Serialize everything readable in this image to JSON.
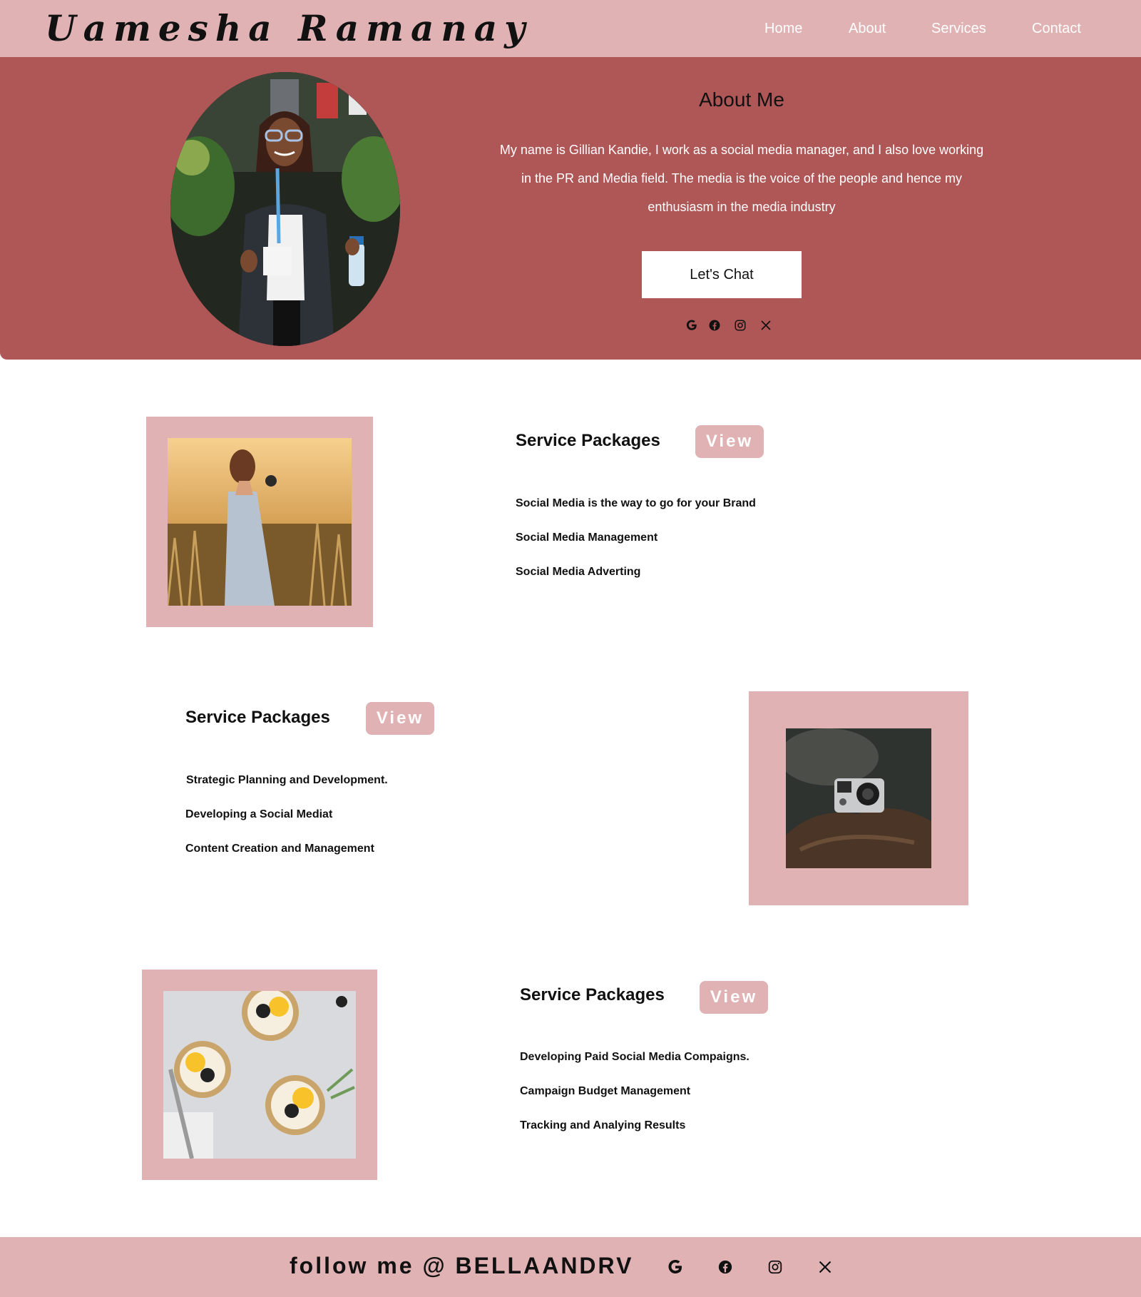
{
  "header": {
    "brand": "Uamesha Ramanay",
    "nav": [
      "Home",
      "About",
      "Services",
      "Contact"
    ]
  },
  "hero": {
    "title": "About Me",
    "text": "My name is Gillian Kandie, I work as a social media manager, and I also love working in the PR and Media field. The media is the voice of the people and hence my enthusiasm in the media industry",
    "button": "Let's Chat",
    "socials": [
      "google-icon",
      "facebook-icon",
      "instagram-icon",
      "x-icon"
    ]
  },
  "services": [
    {
      "title": "Service Packages",
      "view": "View",
      "items": [
        "Social Media is the way to go for your Brand",
        "Social Media Management",
        "Social Media Adverting"
      ]
    },
    {
      "title": "Service Packages",
      "view": "View",
      "items": [
        "Strategic Planning and Development.",
        "Developing a Social Mediat",
        "Content Creation and Management"
      ]
    },
    {
      "title": "Service Packages",
      "view": "View",
      "items": [
        "Developing Paid Social Media Compaigns.",
        "Campaign Budget Management",
        "Tracking and Analying Results"
      ]
    }
  ],
  "footer": {
    "follow": "follow me @ BELLAANDRV",
    "socials": [
      "google-icon",
      "facebook-icon",
      "instagram-icon",
      "x-icon"
    ]
  },
  "colors": {
    "header_pink": "#e0b2b3",
    "hero_red": "#af5656",
    "white": "#ffffff"
  }
}
